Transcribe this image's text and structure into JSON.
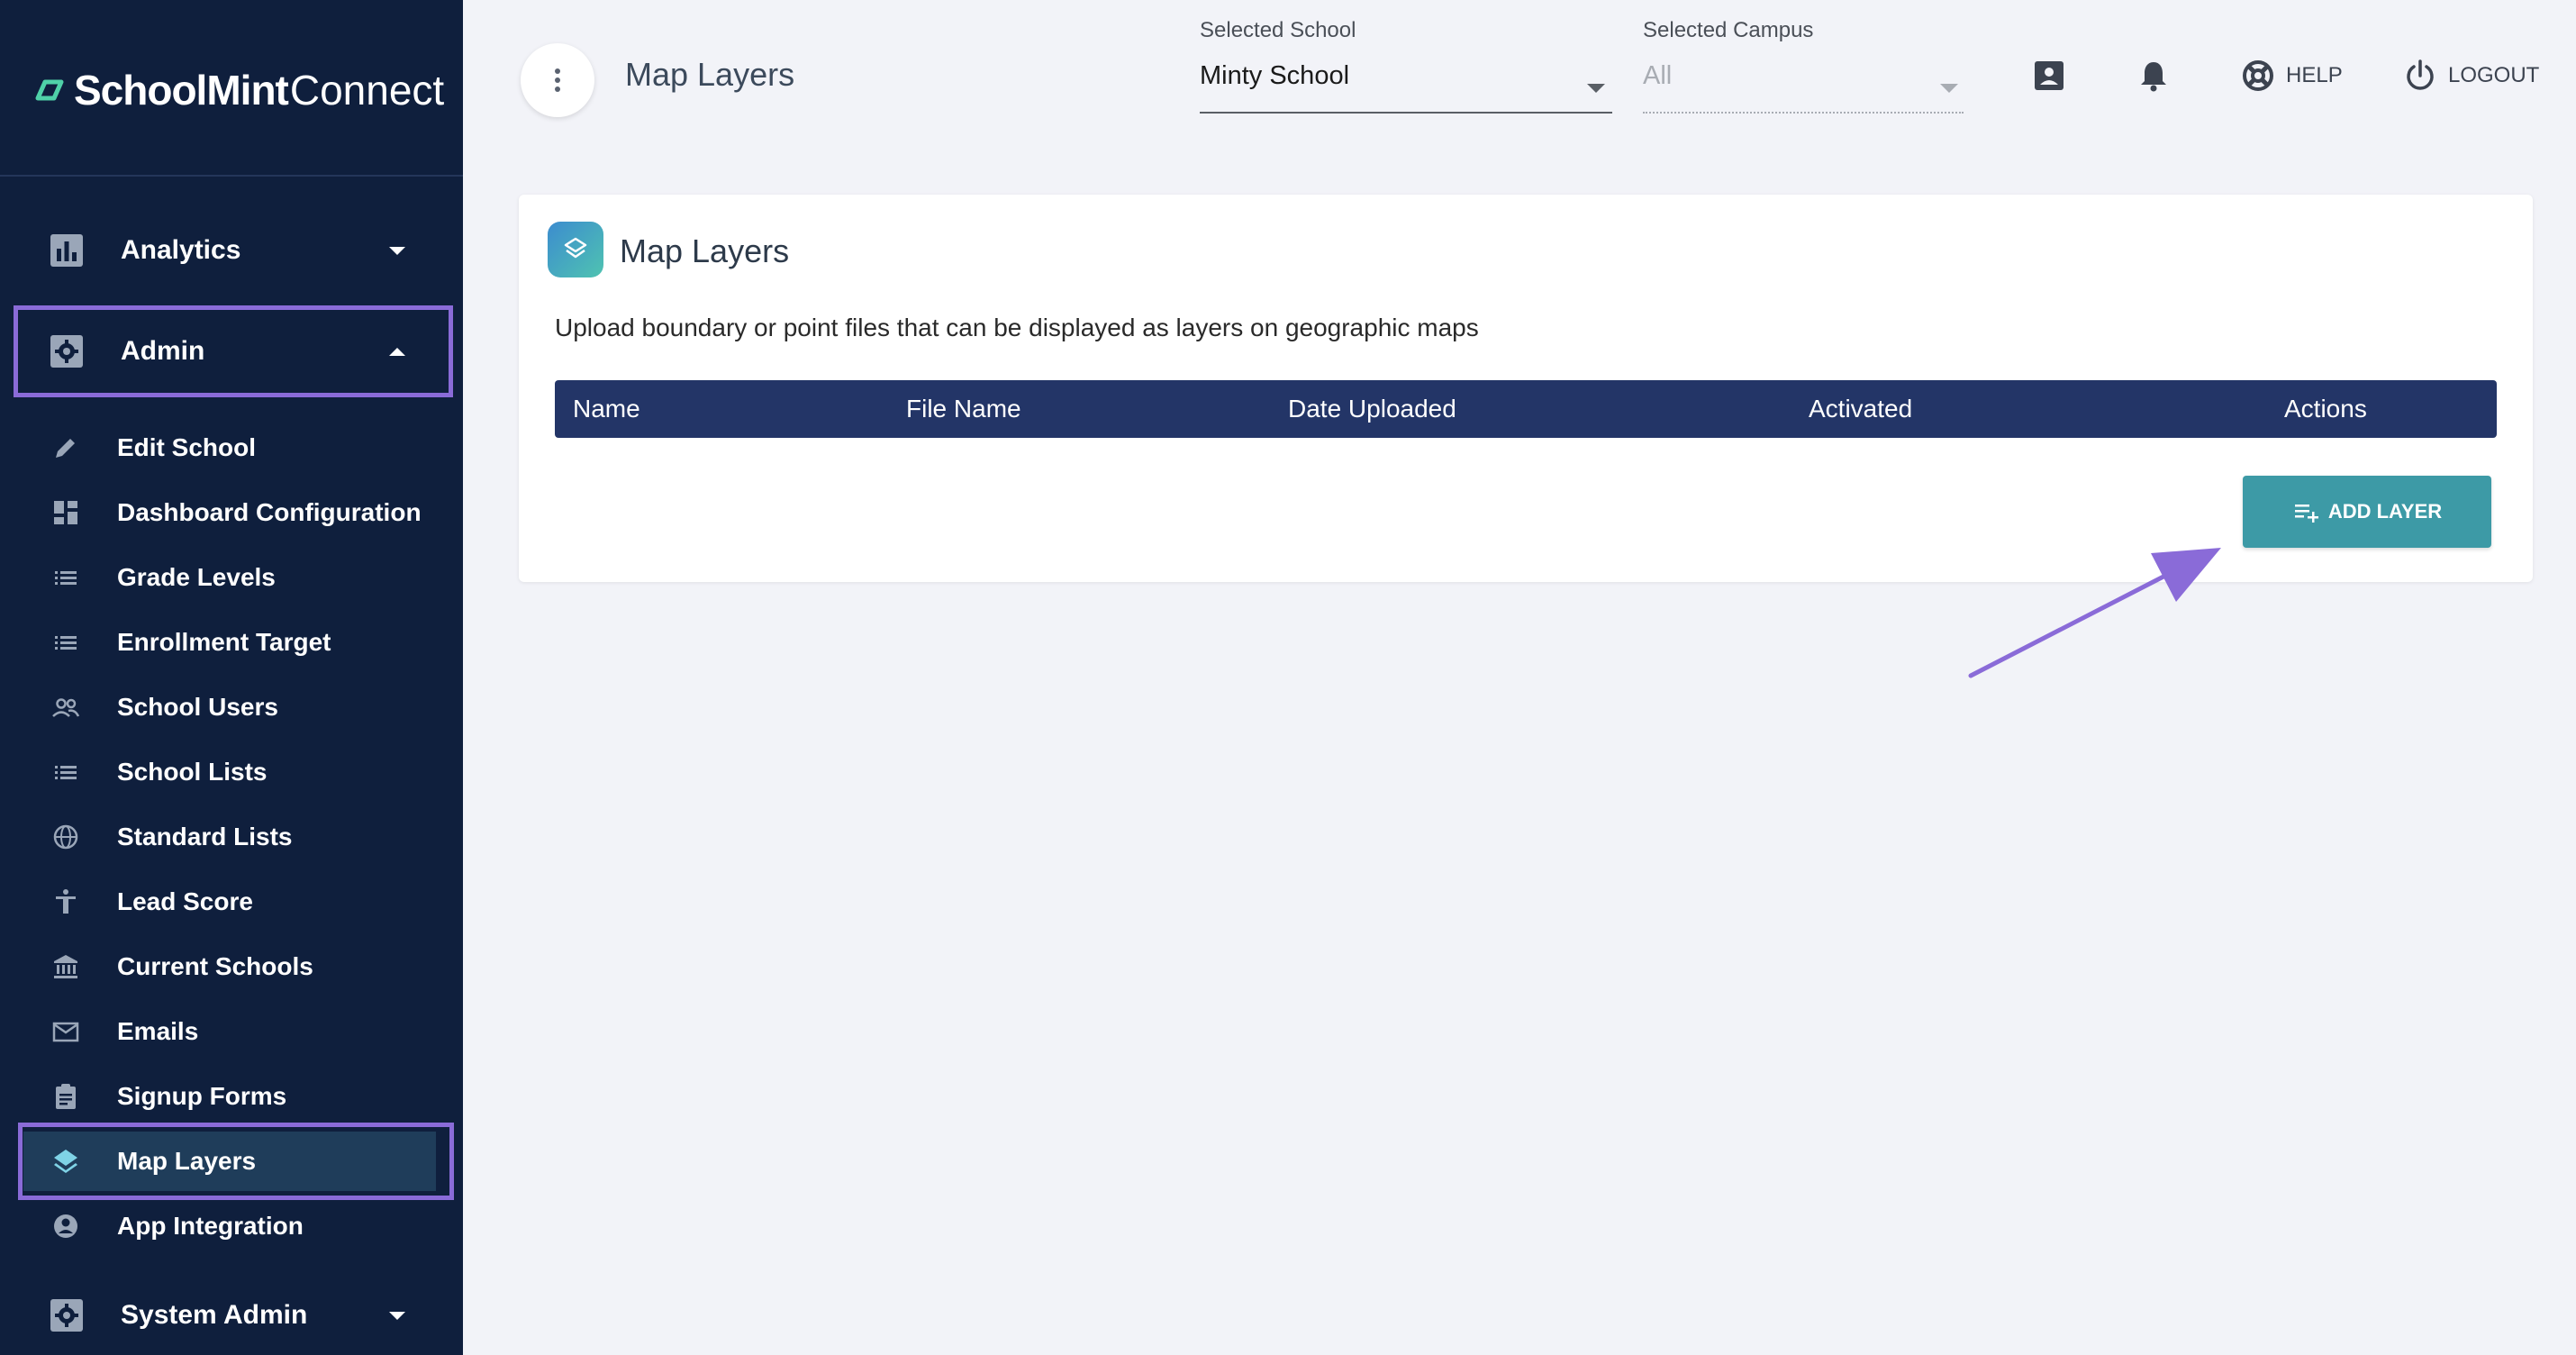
{
  "app": {
    "logo_bold": "SchoolMint",
    "logo_light": "Connect"
  },
  "sidebar": {
    "groups": [
      {
        "label": "Analytics",
        "icon": "bar-chart-icon",
        "expanded": false
      },
      {
        "label": "Admin",
        "icon": "gear-icon",
        "expanded": true
      },
      {
        "label": "System Admin",
        "icon": "gear-icon",
        "expanded": false
      }
    ],
    "items": [
      {
        "label": "Edit School",
        "icon": "pencil-icon"
      },
      {
        "label": "Dashboard Configuration",
        "icon": "dashboard-icon"
      },
      {
        "label": "Grade Levels",
        "icon": "list-icon"
      },
      {
        "label": "Enrollment Target",
        "icon": "list-icon"
      },
      {
        "label": "School Users",
        "icon": "users-icon"
      },
      {
        "label": "School Lists",
        "icon": "list-icon"
      },
      {
        "label": "Standard Lists",
        "icon": "globe-icon"
      },
      {
        "label": "Lead Score",
        "icon": "accessibility-icon"
      },
      {
        "label": "Current Schools",
        "icon": "institution-icon"
      },
      {
        "label": "Emails",
        "icon": "mail-icon"
      },
      {
        "label": "Signup Forms",
        "icon": "clipboard-icon"
      },
      {
        "label": "Map Layers",
        "icon": "layers-icon",
        "active": true
      },
      {
        "label": "App Integration",
        "icon": "account-circle-icon"
      }
    ]
  },
  "header": {
    "page_title": "Map Layers",
    "selected_school_label": "Selected School",
    "selected_school_value": "Minty School",
    "selected_campus_label": "Selected Campus",
    "selected_campus_value": "All",
    "help_label": "HELP",
    "logout_label": "LOGOUT"
  },
  "card": {
    "title": "Map Layers",
    "description": "Upload boundary or point files that can be displayed as layers on geographic maps",
    "columns": [
      "Name",
      "File Name",
      "Date Uploaded",
      "Activated",
      "Actions"
    ],
    "rows": [],
    "add_button_label": "ADD LAYER"
  },
  "colors": {
    "sidebar_bg": "#0f1f3d",
    "table_header_bg": "#233567",
    "accent_button": "#3d9aa6",
    "highlight_outline": "#8a6bd8",
    "annotation_arrow": "#8a6bd8"
  }
}
